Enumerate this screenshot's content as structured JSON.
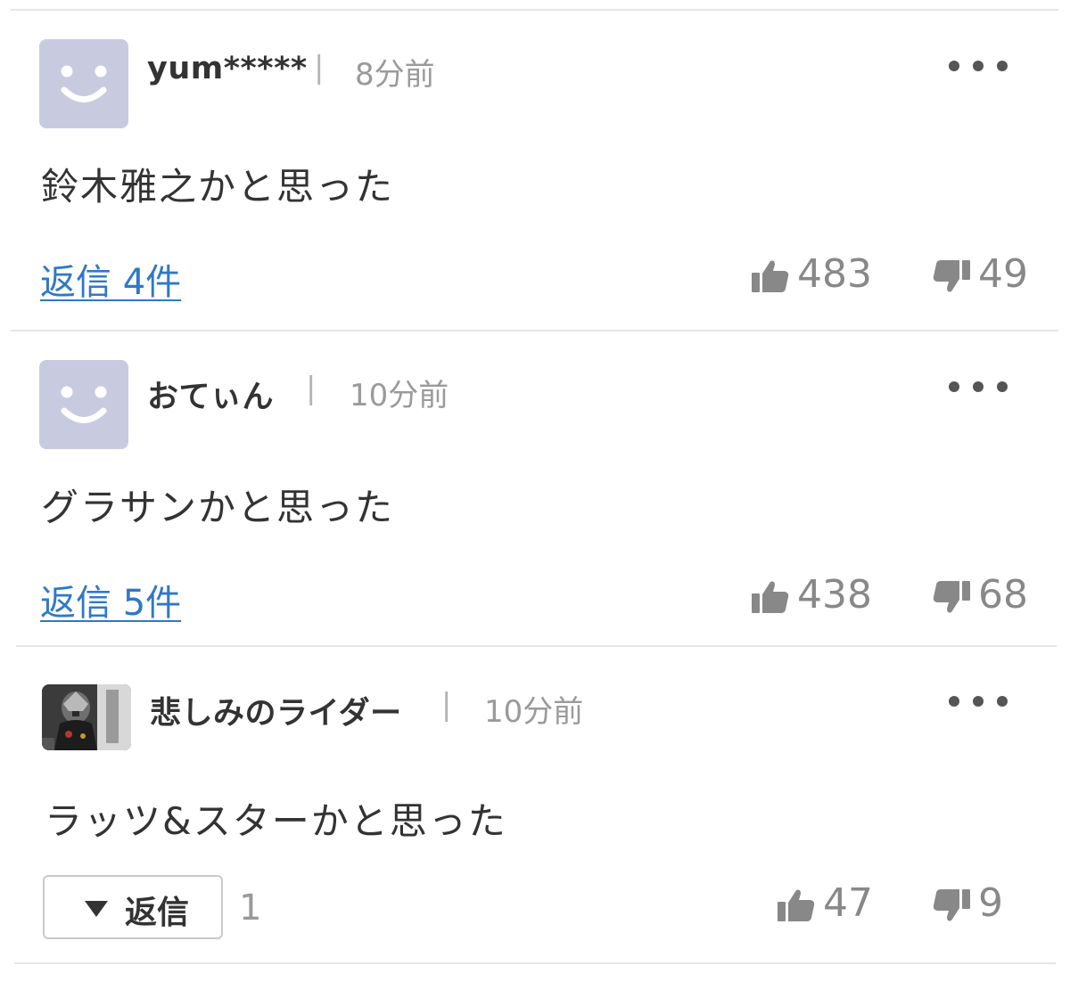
{
  "comments": [
    {
      "username": "yum*****",
      "time": "8分前",
      "text": "鈴木雅之かと思った",
      "reply_link": "返信 4件",
      "likes": "483",
      "dislikes": "49"
    },
    {
      "username": "おてぃん",
      "time": "10分前",
      "text": "グラサンかと思った",
      "reply_link": "返信 5件",
      "likes": "438",
      "dislikes": "68"
    },
    {
      "username": "悲しみのライダー",
      "time": "10分前",
      "text": "ラッツ&スターかと思った",
      "reply_button": "返信",
      "reply_count": "1",
      "likes": "47",
      "dislikes": "9"
    }
  ],
  "separator": "|",
  "icons": {
    "avatar_default": "smiley-avatar-icon",
    "avatar_photo": "rider-photo-avatar",
    "more": "more-dots-icon",
    "like": "thumbs-up-icon",
    "dislike": "thumbs-down-icon",
    "expand": "triangle-down-icon"
  },
  "colors": {
    "avatar_bg": "#c8cbe0",
    "link": "#2f78c8",
    "muted": "#888888",
    "divider": "#e6e6e6"
  }
}
